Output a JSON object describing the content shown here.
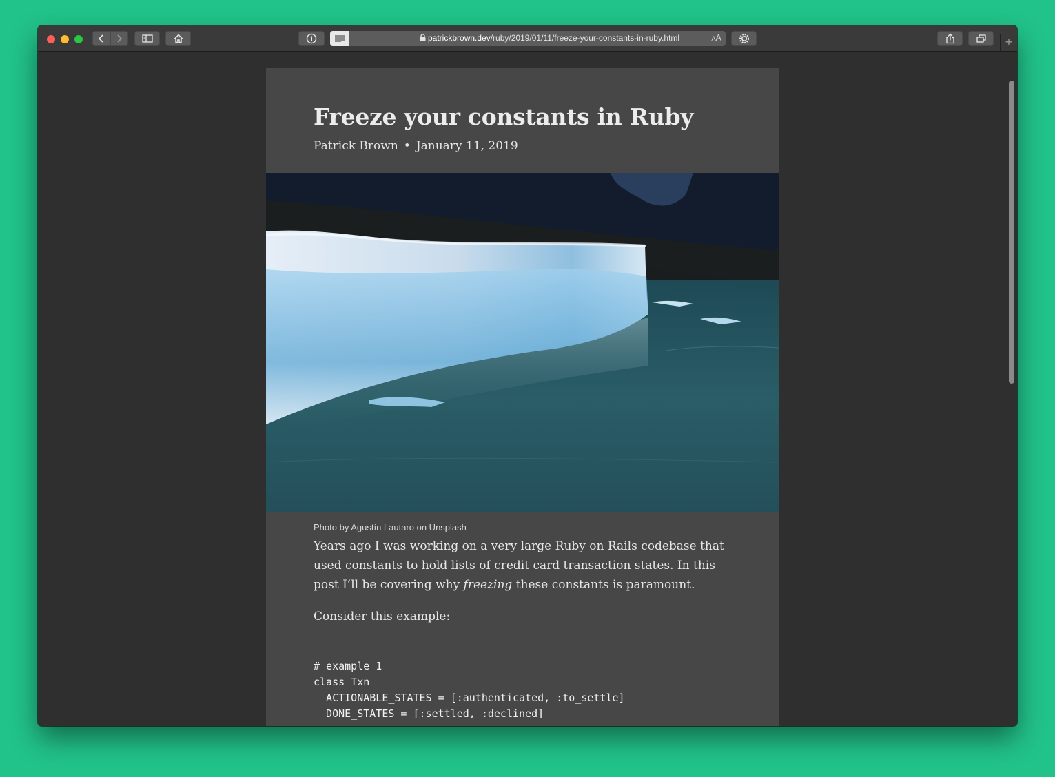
{
  "browser": {
    "url_host": "patrickbrown.dev",
    "url_path": "/ruby/2019/01/11/freeze-your-constants-in-ruby.html",
    "text_size_small": "A",
    "text_size_large": "A",
    "new_tab_symbol": "+"
  },
  "article": {
    "title": "Freeze your constants in Ruby",
    "author": "Patrick Brown",
    "separator": "•",
    "date": "January 11, 2019",
    "caption": "Photo by Agustín Lautaro on Unsplash",
    "intro_1": "Years ago I was working on a very large Ruby on Rails codebase that used constants to hold lists of credit card transaction states. In this post I’ll be covering why ",
    "intro_em": "freezing",
    "intro_2": " these constants is paramount.",
    "consider": "Consider this example:",
    "code_lines": [
      "# example 1",
      "class Txn",
      "  ACTIONABLE_STATES = [:authenticated, :to_settle]",
      "  DONE_STATES = [:settled, :declined]"
    ]
  },
  "colors": {
    "background": "#22c38b",
    "article_bg": "#474748",
    "page_bg": "#2f2f2f"
  }
}
